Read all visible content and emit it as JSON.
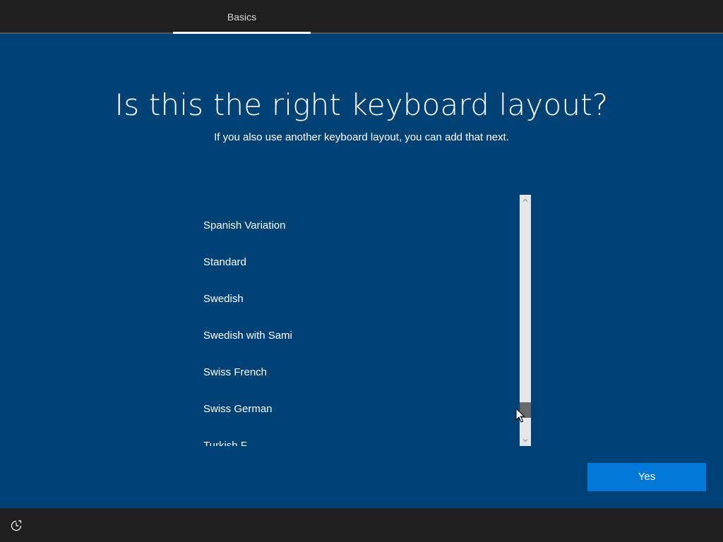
{
  "header": {
    "tabs": [
      {
        "label": "Basics",
        "active": true
      }
    ]
  },
  "main": {
    "title": "Is this the right keyboard layout?",
    "subtitle": "If you also use another keyboard layout, you can add that next.",
    "layouts": [
      "Spanish Variation",
      "Standard",
      "Swedish",
      "Swedish with Sami",
      "Swiss French",
      "Swiss German",
      "Turkish F"
    ],
    "scrollbar": {
      "up_icon": "chevron-up-icon",
      "down_icon": "chevron-down-icon"
    }
  },
  "footer": {
    "yes_label": "Yes",
    "accessibility_icon": "ease-of-access-icon"
  },
  "colors": {
    "background": "#004275",
    "bar": "#1f1f1f",
    "accent_button": "#0078d7",
    "scroll_track": "#e6e6e6",
    "scroll_thumb": "#686868"
  }
}
